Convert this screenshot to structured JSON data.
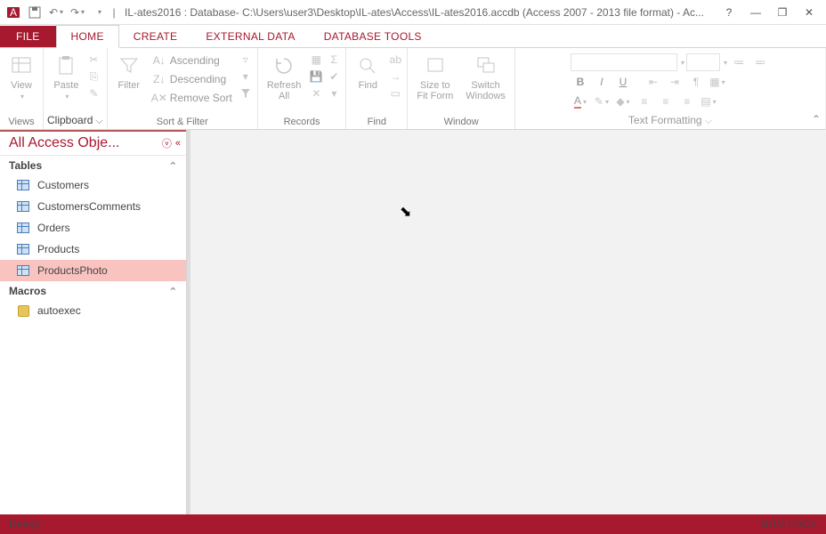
{
  "titlebar": {
    "title": "IL-ates2016 : Database- C:\\Users\\user3\\Desktop\\IL-ates\\Access\\IL-ates2016.accdb (Access 2007 - 2013 file format) - Ac..."
  },
  "tabs": {
    "file": "FILE",
    "home": "HOME",
    "create": "CREATE",
    "external": "EXTERNAL DATA",
    "dbtools": "DATABASE TOOLS"
  },
  "ribbon": {
    "views": {
      "view": "View",
      "label": "Views"
    },
    "clipboard": {
      "paste": "Paste",
      "label": "Clipboard"
    },
    "sortfilter": {
      "filter": "Filter",
      "ascending": "Ascending",
      "descending": "Descending",
      "removesort": "Remove Sort",
      "label": "Sort & Filter"
    },
    "records": {
      "refresh": "Refresh\nAll",
      "label": "Records"
    },
    "find": {
      "find": "Find",
      "label": "Find"
    },
    "window": {
      "sizetofit": "Size to\nFit Form",
      "switch": "Switch\nWindows",
      "label": "Window"
    },
    "textfmt": {
      "label": "Text Formatting"
    }
  },
  "nav": {
    "title": "All Access Obje...",
    "tables": "Tables",
    "macros": "Macros",
    "items": {
      "customers": "Customers",
      "customerscomments": "CustomersComments",
      "orders": "Orders",
      "products": "Products",
      "productsphoto": "ProductsPhoto",
      "autoexec": "autoexec"
    }
  },
  "status": {
    "ready": "Ready",
    "numlock": "NUM LOCK"
  }
}
